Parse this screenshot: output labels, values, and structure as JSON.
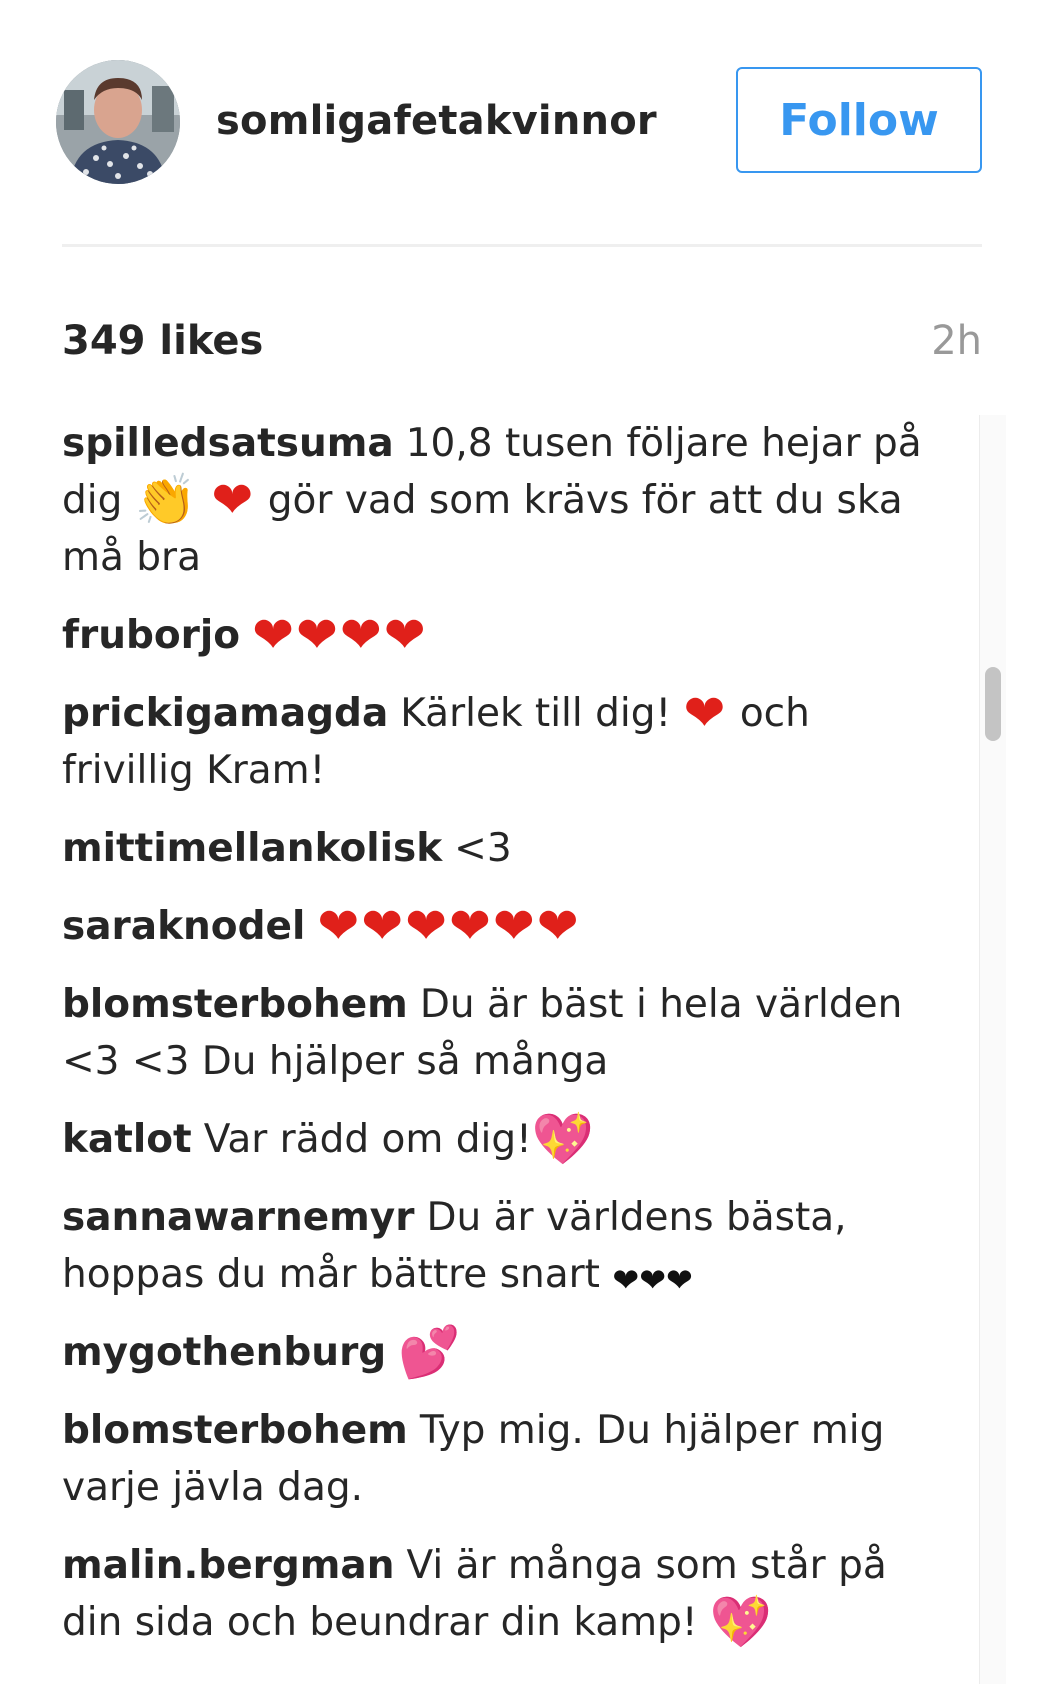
{
  "post": {
    "username": "somligafetakvinnor",
    "follow_label": "Follow",
    "likes": "349 likes",
    "time": "2h"
  },
  "comments": [
    {
      "author": "spilledsatsuma",
      "parts": [
        {
          "t": "text",
          "v": "10,8 tusen följare hejar på dig "
        },
        {
          "t": "emoji",
          "v": "👏",
          "cls": "clap"
        },
        {
          "t": "text",
          "v": " "
        },
        {
          "t": "emoji",
          "v": "❤",
          "cls": "red"
        },
        {
          "t": "text",
          "v": " gör vad som krävs för att du ska må bra"
        }
      ]
    },
    {
      "author": "fruborjo",
      "parts": [
        {
          "t": "emoji",
          "v": "❤❤❤❤",
          "cls": "red"
        }
      ]
    },
    {
      "author": "prickigamagda",
      "parts": [
        {
          "t": "text",
          "v": "Kärlek till dig! "
        },
        {
          "t": "emoji",
          "v": "❤",
          "cls": "red"
        },
        {
          "t": "text",
          "v": " och frivillig Kram!"
        }
      ]
    },
    {
      "author": "mittimellankolisk",
      "parts": [
        {
          "t": "text",
          "v": "<3"
        }
      ]
    },
    {
      "author": "saraknodel",
      "parts": [
        {
          "t": "emoji",
          "v": "❤❤❤❤❤❤",
          "cls": "red"
        }
      ]
    },
    {
      "author": "blomsterbohem",
      "parts": [
        {
          "t": "text",
          "v": "Du är bäst i hela världen <3 <3 Du hjälper så många"
        }
      ]
    },
    {
      "author": "katlot",
      "parts": [
        {
          "t": "text",
          "v": "Var rädd om dig!"
        },
        {
          "t": "emoji",
          "v": "💖",
          "cls": "pink"
        }
      ]
    },
    {
      "author": "sannawarnemyr",
      "parts": [
        {
          "t": "text",
          "v": "Du är världens bästa, hoppas du mår bättre snart "
        },
        {
          "t": "emoji",
          "v": "❤❤❤",
          "cls": "black"
        }
      ]
    },
    {
      "author": "mygothenburg",
      "parts": [
        {
          "t": "emoji",
          "v": "💕",
          "cls": "pink"
        }
      ]
    },
    {
      "author": "blomsterbohem",
      "parts": [
        {
          "t": "text",
          "v": "Typ mig. Du hjälper mig varje jävla dag."
        }
      ]
    },
    {
      "author": "malin.bergman",
      "parts": [
        {
          "t": "text",
          "v": "Vi är många som står på din sida och beundrar din kamp! "
        },
        {
          "t": "emoji",
          "v": "💖",
          "cls": "pink"
        }
      ]
    }
  ],
  "icons": {
    "avatar": "profile-photo"
  },
  "colors": {
    "accent": "#3897f0",
    "text": "#262626",
    "muted": "#999999",
    "divider": "#efefef"
  }
}
